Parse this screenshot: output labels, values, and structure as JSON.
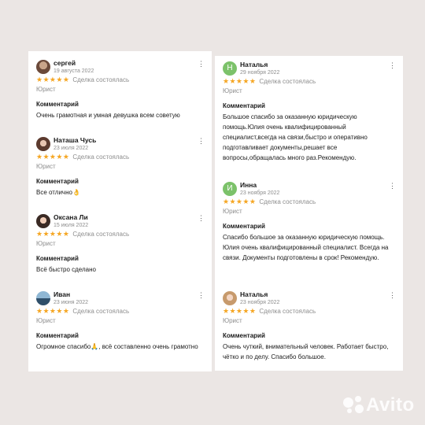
{
  "colors": {
    "star": "#f5a623",
    "background": "#ebe6e4",
    "avatar_green": "#7cc26a"
  },
  "left_column": [
    {
      "name": "сергей",
      "date": "19 августа 2022",
      "stars": "★★★★★",
      "deal": "Сделка состоялась",
      "role": "Юрист",
      "comment_label": "Комментарий",
      "comment": "Очень грамотная и умная девушка всем советую"
    },
    {
      "name": "Наташа Чусь",
      "date": "23 июля 2022",
      "stars": "★★★★★",
      "deal": "Сделка состоялась",
      "role": "Юрист",
      "comment_label": "Комментарий",
      "comment": "Все отлично👌"
    },
    {
      "name": "Оксана Ли",
      "date": "15 июля 2022",
      "stars": "★★★★★",
      "deal": "Сделка состоялась",
      "role": "Юрист",
      "comment_label": "Комментарий",
      "comment": "Всё быстро сделано"
    },
    {
      "name": "Иван",
      "date": "23 июня 2022",
      "stars": "★★★★★",
      "deal": "Сделка состоялась",
      "role": "Юрист",
      "comment_label": "Комментарий",
      "comment": "Огромное спасибо🙏, всё составленно очень грамотно"
    }
  ],
  "right_column": [
    {
      "name": "Наталья",
      "avatar_letter": "Н",
      "date": "29 ноября 2022",
      "stars": "★★★★★",
      "deal": "Сделка состоялась",
      "role": "Юрист",
      "comment_label": "Комментарий",
      "comment": "Большое спасибо за оказанную юридическую помощь.Юлия очень квалифицированный специалист,всегда на связи,быстро и оперативно подготавливает документы,решает все вопросы,обращалась много раз.Рекомендую."
    },
    {
      "name": "Инна",
      "avatar_letter": "И",
      "date": "23 ноября 2022",
      "stars": "★★★★★",
      "deal": "Сделка состоялась",
      "role": "Юрист",
      "comment_label": "Комментарий",
      "comment": "Спасибо большое за оказанную юридическую помощь. Юлия очень квалифицированный специалист. Всегда на связи. Документы подготовлены в срок! Рекомендую."
    },
    {
      "name": "Наталья",
      "date": "23 ноября 2022",
      "stars": "★★★★★",
      "deal": "Сделка состоялась",
      "role": "Юрист",
      "comment_label": "Комментарий",
      "comment": "Очень чуткий, внимательный человек. Работает быстро, чётко и по делу. Спасибо большое."
    }
  ],
  "watermark": {
    "text": "Avito",
    "icon": "avito-logo-icon"
  }
}
